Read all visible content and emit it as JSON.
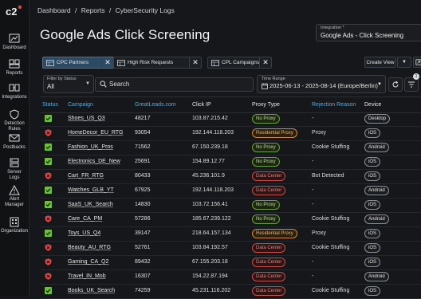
{
  "breadcrumb": [
    "Dashboard",
    "/",
    "Reports",
    "/",
    "CyberSecurity Logs"
  ],
  "page_title": "Google Ads Click Screening",
  "integration": {
    "label": "Integration *",
    "value": "Google Ads - Click Screening"
  },
  "sidebar": {
    "logo_text": "c2",
    "items": [
      {
        "label1": "Dashboard",
        "label2": "",
        "icon": "chart-icon"
      },
      {
        "label1": "Reports",
        "label2": "",
        "icon": "reports-icon"
      },
      {
        "label1": "Integrations",
        "label2": "",
        "icon": "integrations-icon"
      },
      {
        "label1": "Detection",
        "label2": "Rules",
        "icon": "shield-icon"
      },
      {
        "label1": "Postbacks",
        "label2": "",
        "icon": "postbacks-icon"
      },
      {
        "label1": "Server",
        "label2": "Logs",
        "icon": "server-icon"
      },
      {
        "label1": "Alert",
        "label2": "Manager",
        "icon": "alert-icon"
      },
      {
        "label1": "Organization",
        "label2": "",
        "icon": "organization-icon"
      }
    ]
  },
  "chips": [
    {
      "label": "CPC Partners",
      "active": true
    },
    {
      "label": "High Risk Requests",
      "active": false
    },
    {
      "label": "CPL Campaigns",
      "active": false
    }
  ],
  "toolbar": {
    "create_view": "Create View",
    "filter_count": "1"
  },
  "filters": {
    "status_label": "Filter by Status",
    "status_value": "All",
    "search_placeholder": "Search",
    "time_label": "Time Range",
    "time_value": "2025-06-13 - 2025-08-14 (Europe/Berlin)"
  },
  "columns": [
    "Status",
    "Campaign",
    "GreatLeads.com",
    "Click IP",
    "Proxy Type",
    "Rejection Reason",
    "Device"
  ],
  "colors": {
    "ok": "#6fbf3a",
    "bad": "#e04646",
    "link": "#5fa8d3"
  },
  "rows": [
    {
      "status": "ok",
      "campaign": "Shoes_US_Q3",
      "gl": "48217",
      "ip": "103.87.215.42",
      "proxy": "No Proxy",
      "reason": "-",
      "device": "Desktop"
    },
    {
      "status": "bad",
      "campaign": "HomeDecor_EU_RTG",
      "gl": "93054",
      "ip": "192.144.118.203",
      "proxy": "Residential Proxy",
      "reason": "Proxy",
      "device": "iOS"
    },
    {
      "status": "ok",
      "campaign": "Fashion_UK_Pros",
      "gl": "71562",
      "ip": "67.150.239.18",
      "proxy": "No Proxy",
      "reason": "Cookie Stuffing",
      "device": "Android"
    },
    {
      "status": "ok",
      "campaign": "Electronics_DE_New",
      "gl": "25691",
      "ip": "154.89.12.77",
      "proxy": "No Proxy",
      "reason": "-",
      "device": "iOS"
    },
    {
      "status": "bad",
      "campaign": "Cart_FR_RTG",
      "gl": "80433",
      "ip": "45.236.101.9",
      "proxy": "Data Center",
      "reason": "Bot Detected",
      "device": "iOS"
    },
    {
      "status": "ok",
      "campaign": "Watches_GLB_YT",
      "gl": "67925",
      "ip": "192.144.118.203",
      "proxy": "Data Center",
      "reason": "-",
      "device": "Android"
    },
    {
      "status": "ok",
      "campaign": "SaaS_UK_Search",
      "gl": "14830",
      "ip": "103.72.156.41",
      "proxy": "No Proxy",
      "reason": "-",
      "device": "iOS"
    },
    {
      "status": "bad",
      "campaign": "Care_CA_PM",
      "gl": "57286",
      "ip": "185.67.239.122",
      "proxy": "No Proxy",
      "reason": "Cookie Stuffing",
      "device": "Android"
    },
    {
      "status": "ok",
      "campaign": "Toys_US_Q4",
      "gl": "39147",
      "ip": "218.64.157.134",
      "proxy": "Residential Proxy",
      "reason": "Proxy",
      "device": "iOS"
    },
    {
      "status": "bad",
      "campaign": "Beauty_AU_RTG",
      "gl": "52761",
      "ip": "103.84.192.57",
      "proxy": "Data Center",
      "reason": "Cookie Stuffing",
      "device": "iOS"
    },
    {
      "status": "bad",
      "campaign": "Gaming_CA_Q2",
      "gl": "89432",
      "ip": "67.155.203.18",
      "proxy": "Data Center",
      "reason": "-",
      "device": "iOS"
    },
    {
      "status": "bad",
      "campaign": "Travel_IN_Mob",
      "gl": "16307",
      "ip": "154.22.87.194",
      "proxy": "Data Center",
      "reason": "-",
      "device": "Android"
    },
    {
      "status": "ok",
      "campaign": "Books_UK_Search",
      "gl": "74259",
      "ip": "45.231.116.202",
      "proxy": "Data Center",
      "reason": "Cookie Stuffing",
      "device": "iOS"
    }
  ]
}
